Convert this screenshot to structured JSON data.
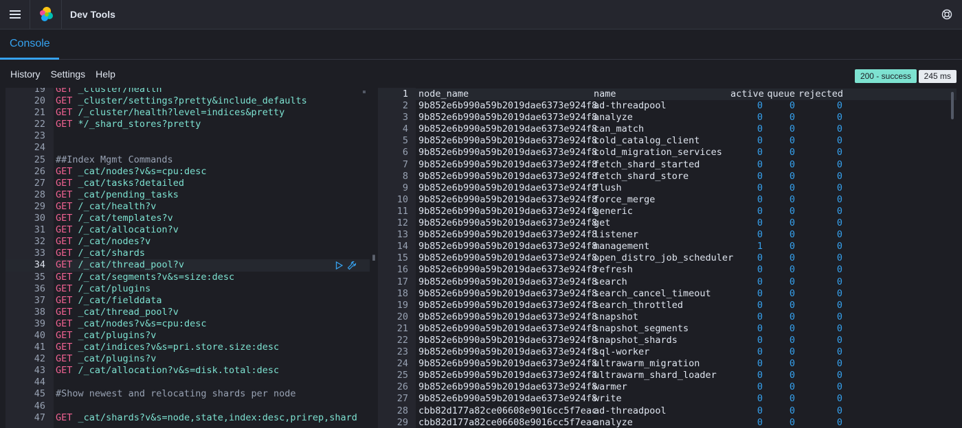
{
  "header": {
    "title": "Dev Tools"
  },
  "tabs": [
    {
      "label": "Console"
    }
  ],
  "toolbar": {
    "history": "History",
    "settings": "Settings",
    "help": "Help"
  },
  "status": {
    "code": "200 - success",
    "time": "245 ms"
  },
  "editor": {
    "lines": [
      {
        "n": "19",
        "kw": "GET",
        "path": "_cluster/health"
      },
      {
        "n": "20",
        "kw": "GET",
        "path": "_cluster/settings?pretty&include_defaults"
      },
      {
        "n": "21",
        "kw": "GET",
        "path": "/_cluster/health?level=indices&pretty"
      },
      {
        "n": "22",
        "kw": "GET",
        "path": "*/_shard_stores?pretty"
      },
      {
        "n": "23"
      },
      {
        "n": "24"
      },
      {
        "n": "25",
        "comment": "##Index Mgmt Commands"
      },
      {
        "n": "26",
        "kw": "GET",
        "path": "_cat/nodes?v&s=cpu:desc"
      },
      {
        "n": "27",
        "kw": "GET",
        "path": "_cat/tasks?detailed"
      },
      {
        "n": "28",
        "kw": "GET",
        "path": "_cat/pending_tasks"
      },
      {
        "n": "29",
        "kw": "GET",
        "path": "/_cat/health?v"
      },
      {
        "n": "30",
        "kw": "GET",
        "path": "/_cat/templates?v"
      },
      {
        "n": "31",
        "kw": "GET",
        "path": "/_cat/allocation?v"
      },
      {
        "n": "32",
        "kw": "GET",
        "path": "/_cat/nodes?v"
      },
      {
        "n": "33",
        "kw": "GET",
        "path": "/_cat/shards"
      },
      {
        "n": "34",
        "kw": "GET",
        "path": "/_cat/thread_pool?v",
        "active": true
      },
      {
        "n": "35",
        "kw": "GET",
        "path": "/_cat/segments?v&s=size:desc"
      },
      {
        "n": "36",
        "kw": "GET",
        "path": "/_cat/plugins"
      },
      {
        "n": "37",
        "kw": "GET",
        "path": "/_cat/fielddata"
      },
      {
        "n": "38",
        "kw": "GET",
        "path": "_cat/thread_pool?v"
      },
      {
        "n": "39",
        "kw": "GET",
        "path": "_cat/nodes?v&s=cpu:desc"
      },
      {
        "n": "40",
        "kw": "GET",
        "path": "_cat/plugins?v"
      },
      {
        "n": "41",
        "kw": "GET",
        "path": "_cat/indices?v&s=pri.store.size:desc"
      },
      {
        "n": "42",
        "kw": "GET",
        "path": "_cat/plugins?v"
      },
      {
        "n": "43",
        "kw": "GET",
        "path": "/_cat/allocation?v&s=disk.total:desc"
      },
      {
        "n": "44"
      },
      {
        "n": "45",
        "comment": "#Show newest and relocating shards per node"
      },
      {
        "n": "46"
      },
      {
        "n": "47",
        "kw": "GET",
        "path": "_cat/shards?v&s=node,state,index:desc,prirep,shard"
      }
    ]
  },
  "output": {
    "header": {
      "n": "1",
      "node": "node_name",
      "name": "name",
      "active": "active",
      "queue": "queue",
      "rejected": "rejected"
    },
    "rows": [
      {
        "n": "2",
        "node": "9b852e6b990a59b2019dae6373e924f8",
        "name": "ad-threadpool",
        "active": "0",
        "queue": "0",
        "rejected": "0"
      },
      {
        "n": "3",
        "node": "9b852e6b990a59b2019dae6373e924f8",
        "name": "analyze",
        "active": "0",
        "queue": "0",
        "rejected": "0"
      },
      {
        "n": "4",
        "node": "9b852e6b990a59b2019dae6373e924f8",
        "name": "can_match",
        "active": "0",
        "queue": "0",
        "rejected": "0"
      },
      {
        "n": "5",
        "node": "9b852e6b990a59b2019dae6373e924f8",
        "name": "cold_catalog_client",
        "active": "0",
        "queue": "0",
        "rejected": "0"
      },
      {
        "n": "6",
        "node": "9b852e6b990a59b2019dae6373e924f8",
        "name": "cold_migration_services",
        "active": "0",
        "queue": "0",
        "rejected": "0"
      },
      {
        "n": "7",
        "node": "9b852e6b990a59b2019dae6373e924f8",
        "name": "fetch_shard_started",
        "active": "0",
        "queue": "0",
        "rejected": "0"
      },
      {
        "n": "8",
        "node": "9b852e6b990a59b2019dae6373e924f8",
        "name": "fetch_shard_store",
        "active": "0",
        "queue": "0",
        "rejected": "0"
      },
      {
        "n": "9",
        "node": "9b852e6b990a59b2019dae6373e924f8",
        "name": "flush",
        "active": "0",
        "queue": "0",
        "rejected": "0"
      },
      {
        "n": "10",
        "node": "9b852e6b990a59b2019dae6373e924f8",
        "name": "force_merge",
        "active": "0",
        "queue": "0",
        "rejected": "0"
      },
      {
        "n": "11",
        "node": "9b852e6b990a59b2019dae6373e924f8",
        "name": "generic",
        "active": "0",
        "queue": "0",
        "rejected": "0"
      },
      {
        "n": "12",
        "node": "9b852e6b990a59b2019dae6373e924f8",
        "name": "get",
        "active": "0",
        "queue": "0",
        "rejected": "0"
      },
      {
        "n": "13",
        "node": "9b852e6b990a59b2019dae6373e924f8",
        "name": "listener",
        "active": "0",
        "queue": "0",
        "rejected": "0"
      },
      {
        "n": "14",
        "node": "9b852e6b990a59b2019dae6373e924f8",
        "name": "management",
        "active": "1",
        "queue": "0",
        "rejected": "0"
      },
      {
        "n": "15",
        "node": "9b852e6b990a59b2019dae6373e924f8",
        "name": "open_distro_job_scheduler",
        "active": "0",
        "queue": "0",
        "rejected": "0"
      },
      {
        "n": "16",
        "node": "9b852e6b990a59b2019dae6373e924f8",
        "name": "refresh",
        "active": "0",
        "queue": "0",
        "rejected": "0"
      },
      {
        "n": "17",
        "node": "9b852e6b990a59b2019dae6373e924f8",
        "name": "search",
        "active": "0",
        "queue": "0",
        "rejected": "0"
      },
      {
        "n": "18",
        "node": "9b852e6b990a59b2019dae6373e924f8",
        "name": "search_cancel_timeout",
        "active": "0",
        "queue": "0",
        "rejected": "0"
      },
      {
        "n": "19",
        "node": "9b852e6b990a59b2019dae6373e924f8",
        "name": "search_throttled",
        "active": "0",
        "queue": "0",
        "rejected": "0"
      },
      {
        "n": "20",
        "node": "9b852e6b990a59b2019dae6373e924f8",
        "name": "snapshot",
        "active": "0",
        "queue": "0",
        "rejected": "0"
      },
      {
        "n": "21",
        "node": "9b852e6b990a59b2019dae6373e924f8",
        "name": "snapshot_segments",
        "active": "0",
        "queue": "0",
        "rejected": "0"
      },
      {
        "n": "22",
        "node": "9b852e6b990a59b2019dae6373e924f8",
        "name": "snapshot_shards",
        "active": "0",
        "queue": "0",
        "rejected": "0"
      },
      {
        "n": "23",
        "node": "9b852e6b990a59b2019dae6373e924f8",
        "name": "sql-worker",
        "active": "0",
        "queue": "0",
        "rejected": "0"
      },
      {
        "n": "24",
        "node": "9b852e6b990a59b2019dae6373e924f8",
        "name": "ultrawarm_migration",
        "active": "0",
        "queue": "0",
        "rejected": "0"
      },
      {
        "n": "25",
        "node": "9b852e6b990a59b2019dae6373e924f8",
        "name": "ultrawarm_shard_loader",
        "active": "0",
        "queue": "0",
        "rejected": "0"
      },
      {
        "n": "26",
        "node": "9b852e6b990a59b2019dae6373e924f8",
        "name": "warmer",
        "active": "0",
        "queue": "0",
        "rejected": "0"
      },
      {
        "n": "27",
        "node": "9b852e6b990a59b2019dae6373e924f8",
        "name": "write",
        "active": "0",
        "queue": "0",
        "rejected": "0"
      },
      {
        "n": "28",
        "node": "cbb82d177a82ce06608e9016cc5f7eac",
        "name": "ad-threadpool",
        "active": "0",
        "queue": "0",
        "rejected": "0"
      },
      {
        "n": "29",
        "node": "cbb82d177a82ce06608e9016cc5f7eac",
        "name": "analyze",
        "active": "0",
        "queue": "0",
        "rejected": "0"
      }
    ]
  },
  "icons": {
    "menu": "hamburger-menu-icon",
    "logo": "elastic-logo-icon",
    "help": "help-lifebuoy-icon",
    "run": "play-icon",
    "wrench": "wrench-icon"
  },
  "colors": {
    "background": "#1d1e24",
    "accent": "#36a2ef",
    "keyword": "#f06292",
    "path": "#7de2d1",
    "success": "#7de2d1"
  }
}
